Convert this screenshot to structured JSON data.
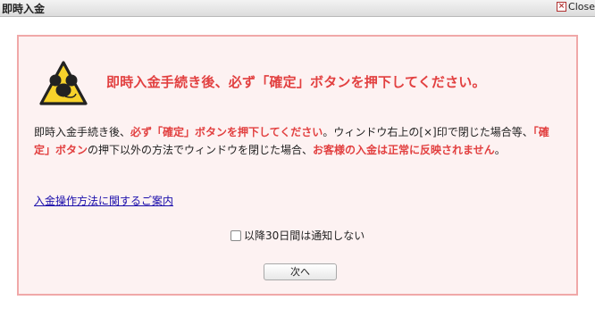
{
  "window": {
    "title": "即時入金",
    "close_label": "Close"
  },
  "notice": {
    "headline": "即時入金手続き後、必ず「確定」ボタンを押下してください。",
    "body": {
      "p1": "即時入金手続き後、",
      "p2": "必ず「確定」ボタンを押下してください",
      "p3": "。ウィンドウ右上の[×]印で閉じた場合等、",
      "p4": "「確定」ボタン",
      "p5": "の押下以外の方法でウィンドウを閉じた場合、",
      "p6": "お客様の入金は正常に反映されません",
      "p7": "。"
    },
    "help_link": "入金操作方法に関するご案内",
    "checkbox_label": "以降30日間は通知しない",
    "checkbox_checked": false,
    "next_button": "次へ"
  },
  "colors": {
    "accent_red": "#e24040",
    "panel_bg": "#fdf2f2",
    "panel_border": "#f0a8a8",
    "warning_yellow": "#f7d22b"
  },
  "icons": {
    "warning": "mouse-warning-icon",
    "close": "close-icon"
  }
}
